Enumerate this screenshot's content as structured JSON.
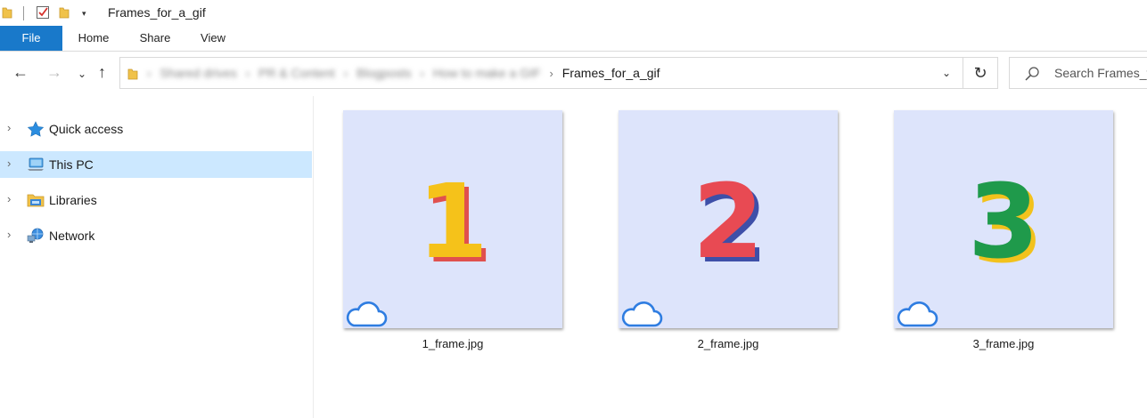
{
  "window": {
    "title": "Frames_for_a_gif"
  },
  "quick_access_toolbar": {
    "icons": [
      "folder-icon",
      "properties-check-icon",
      "new-folder-icon",
      "customize-dropdown-icon"
    ],
    "dropdown_glyph": "▾"
  },
  "ribbon": {
    "tabs": [
      {
        "label": "File",
        "active": true
      },
      {
        "label": "Home"
      },
      {
        "label": "Share"
      },
      {
        "label": "View"
      }
    ],
    "file_tab_color": "#1979ca"
  },
  "navigation": {
    "back": "←",
    "forward": "→",
    "recent": "⌄",
    "up": "↑"
  },
  "address_bar": {
    "blurred_segments": [
      "Shared drives",
      "PR & Content",
      "Blogposts",
      "How to make a GIF"
    ],
    "separator": "›",
    "current_folder": "Frames_for_a_gif",
    "dropdown_glyph": "⌄",
    "refresh_glyph": "↻"
  },
  "search": {
    "placeholder": "Search Frames_for_a_gif"
  },
  "sidebar": {
    "items": [
      {
        "label": "Quick access",
        "icon": "star-icon",
        "selected": false
      },
      {
        "label": "This PC",
        "icon": "computer-icon",
        "selected": true
      },
      {
        "label": "Libraries",
        "icon": "libraries-icon",
        "selected": false
      },
      {
        "label": "Network",
        "icon": "network-icon",
        "selected": false
      }
    ],
    "chevron": "›",
    "selected_color": "#cce8ff"
  },
  "files": [
    {
      "name": "1_frame.jpg",
      "thumb_digit": "1",
      "digit_color": "#f5c21a",
      "shadow_color": "#e0504e",
      "sync_status": "cloud-icon"
    },
    {
      "name": "2_frame.jpg",
      "thumb_digit": "2",
      "digit_color": "#e84a53",
      "shadow_color": "#3e4fa8",
      "sync_status": "cloud-icon"
    },
    {
      "name": "3_frame.jpg",
      "thumb_digit": "3",
      "digit_color": "#1f9a4b",
      "shadow_color": "#f2c21c",
      "sync_status": "cloud-icon"
    }
  ],
  "colors": {
    "thumb_background": "#dde4fb",
    "cloud_stroke": "#2f7de1"
  }
}
